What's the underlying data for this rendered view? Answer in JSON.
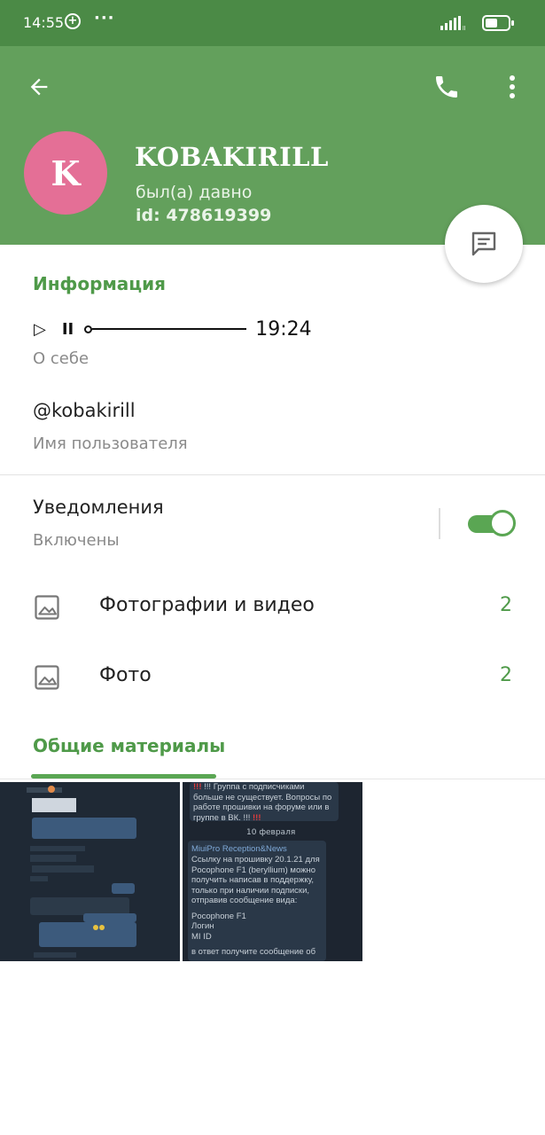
{
  "status_bar": {
    "time": "14:55",
    "plus_icon": "+",
    "more_dots": "···",
    "icons": [
      "signal-icon",
      "battery-icon"
    ],
    "battery_level": 0.55
  },
  "header": {
    "back_icon": "arrow-left-icon",
    "call_icon": "phone-icon",
    "more_icon": "more-vertical-icon",
    "avatar_letter": "K",
    "name": "KOBAKIRILL",
    "status": "был(а) давно",
    "id": "id: 478619399",
    "colors": {
      "header": "#63a05c",
      "status_bar": "#4b8a46",
      "avatar": "#e46f96",
      "accent": "#4f9a49"
    }
  },
  "fab": {
    "icon": "message-icon"
  },
  "info": {
    "section_title": "Информация",
    "audio": {
      "play": "▷",
      "pause": "II",
      "time": "19:24"
    },
    "about_label": "О себе",
    "username": "@kobakirill",
    "username_label": "Имя пользователя"
  },
  "notifications": {
    "title": "Уведомления",
    "subtitle": "Включены",
    "enabled": true
  },
  "media": [
    {
      "label": "Фотографии и видео",
      "count": "2",
      "icon": "image-icon"
    },
    {
      "label": "Фото",
      "count": "2",
      "icon": "image-icon"
    }
  ],
  "shared": {
    "tab_title": "Общие материалы",
    "thumb2_lines": [
      "!!! Группа с подписчиками",
      "больше не существует. Вопросы по",
      "работе прошивки на форуме или в",
      "группе в ВК. !!!",
      "10 февраля",
      "MiuiPro Reception&News",
      "Ссылку на прошивку 20.1.21 для",
      "Pocophone F1 (beryllium) можно",
      "получить написав в  поддержку,",
      "только при наличии подписки,",
      "отправив сообщение вида:",
      "Pocophone F1",
      "Логин",
      "MI ID",
      "в ответ получите сообщение об"
    ]
  }
}
